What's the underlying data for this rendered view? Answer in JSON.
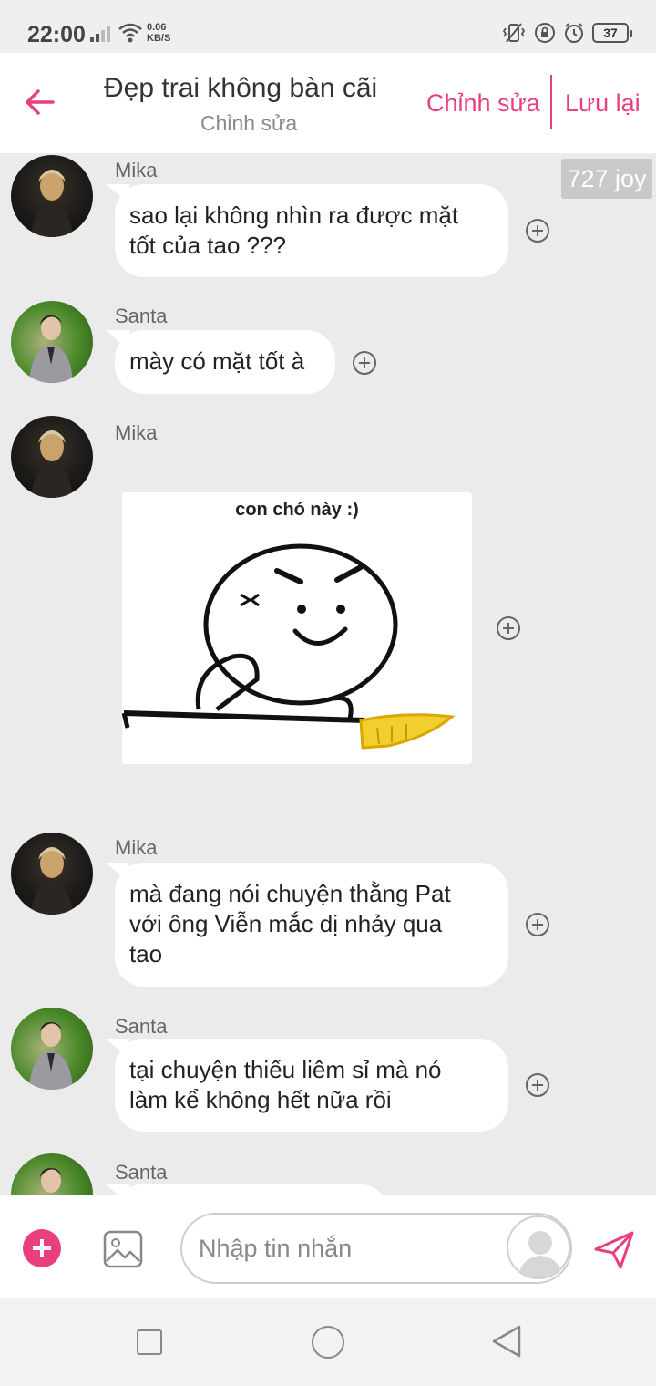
{
  "status_bar": {
    "time": "22:00",
    "net_speed_value": "0.06",
    "net_speed_unit": "KB/S",
    "battery": "37",
    "icons": [
      "signal-icon",
      "wifi-icon",
      "vibrate-icon",
      "lock-rotation-icon",
      "alarm-icon",
      "battery-icon"
    ]
  },
  "header": {
    "back_icon": "back-arrow-icon",
    "title": "Đẹp trai không bàn cãi",
    "subtitle": "Chỉnh sửa",
    "edit_label": "Chỉnh sửa",
    "save_label": "Lưu lại"
  },
  "joy_badge": "727 joy",
  "messages": [
    {
      "sender": "Mika",
      "text": "sao lại không nhìn ra được mặt\ntốt của tao ???"
    },
    {
      "sender": "Santa",
      "text": "mày có mặt tốt à"
    },
    {
      "sender": "Mika",
      "sticker_caption": "con chó này :)"
    },
    {
      "sender": "Mika",
      "text": "mà đang nói chuyện thằng Pat\nvới ông Viễn mắc dị nhảy qua\ntao"
    },
    {
      "sender": "Santa",
      "text": "tại chuyện thiếu liêm sỉ mà nó\nlàm kể không hết nữa rồi"
    },
    {
      "sender": "Santa",
      "text": ""
    }
  ],
  "input_bar": {
    "placeholder": "Nhập tin nhắn",
    "icons": [
      "add-icon",
      "image-icon",
      "avatar-icon",
      "send-icon"
    ]
  },
  "colors": {
    "accent": "#ea3f7f",
    "chat_background": "#ebebeb",
    "bubble": "#ffffff"
  }
}
